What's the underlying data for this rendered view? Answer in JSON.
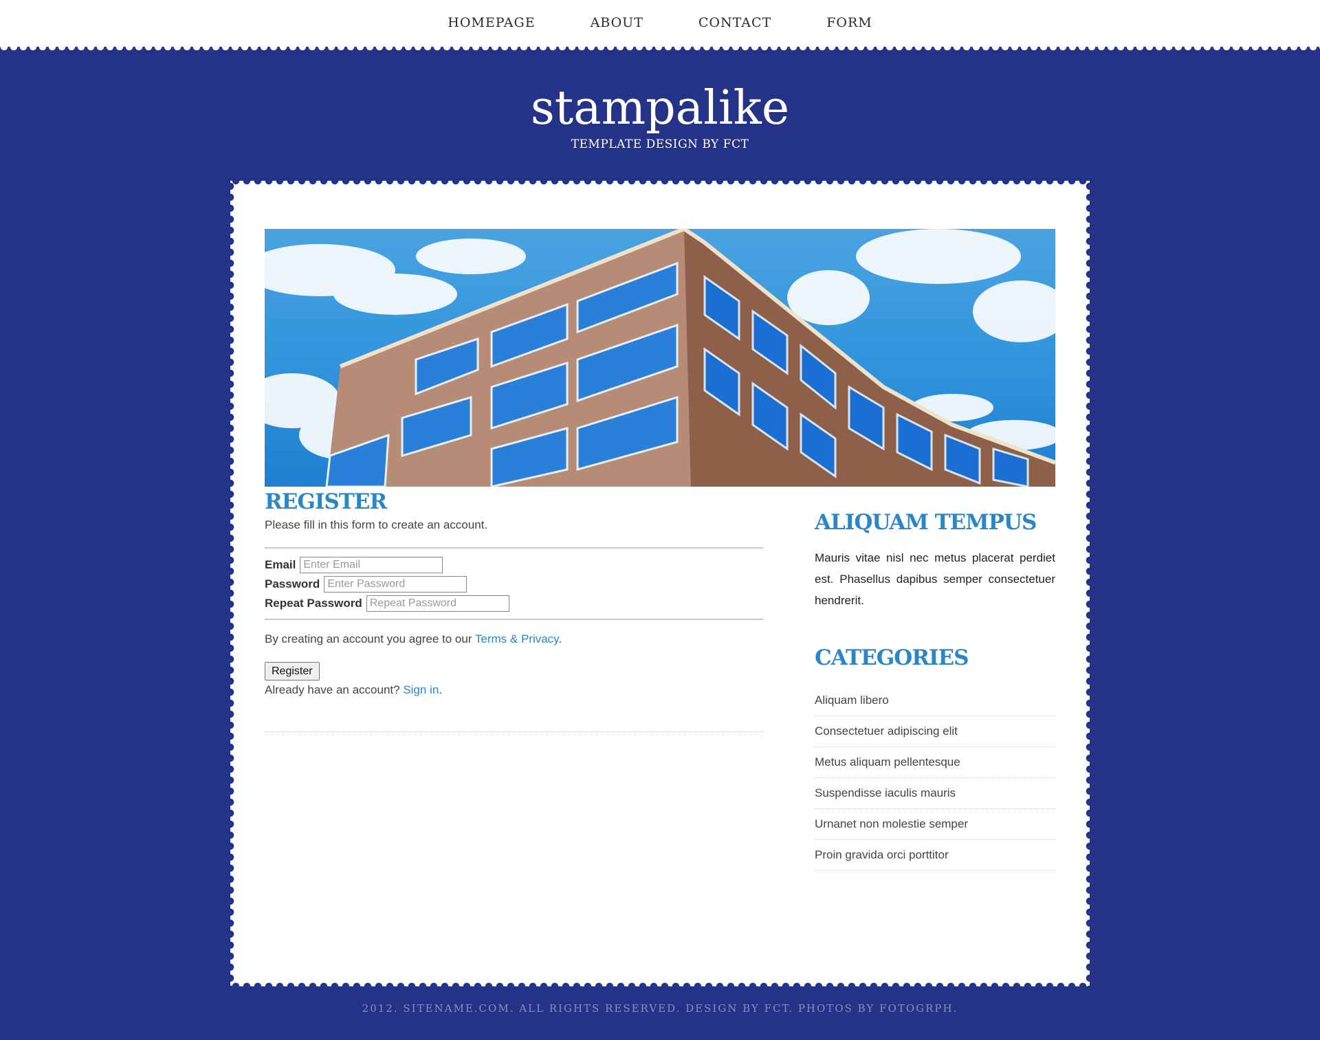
{
  "nav": {
    "items": [
      {
        "label": "HOMEPAGE"
      },
      {
        "label": "ABOUT"
      },
      {
        "label": "CONTACT"
      },
      {
        "label": "FORM"
      }
    ]
  },
  "header": {
    "title": "stampalike",
    "tagline": "TEMPLATE DESIGN BY FCT"
  },
  "colors": {
    "background": "#243387",
    "accent": "#2b86c8",
    "paper": "#ffffff"
  },
  "register": {
    "heading": "REGISTER",
    "intro": "Please fill in this form to create an account.",
    "fields": [
      {
        "label": "Email",
        "placeholder": "Enter Email",
        "value": ""
      },
      {
        "label": "Password",
        "placeholder": "Enter Password",
        "value": ""
      },
      {
        "label": "Repeat Password",
        "placeholder": "Repeat Password",
        "value": ""
      }
    ],
    "agree_text": "By creating an account you agree to our ",
    "terms_link": "Terms & Privacy",
    "agree_end": ".",
    "button_label": "Register",
    "signin_text": "Already have an account? ",
    "signin_link": "Sign in",
    "signin_end": "."
  },
  "sidebar": {
    "about_heading": "ALIQUAM TEMPUS",
    "about_text": "Mauris vitae nisl nec metus placerat perdiet est. Phasellus dapibus semper consectetuer hendrerit.",
    "categories_heading": "CATEGORIES",
    "categories": [
      "Aliquam libero",
      "Consectetuer adipiscing elit",
      "Metus aliquam pellentesque",
      "Suspendisse iaculis mauris",
      "Urnanet non molestie semper",
      "Proin gravida orci porttitor"
    ]
  },
  "footer": {
    "text": "2012. SITENAME.COM. ALL RIGHTS RESERVED. DESIGN BY ",
    "design_link": "FCT",
    "middle": ". PHOTOS BY ",
    "photos_link": "FOTOGRPH",
    "end": "."
  }
}
